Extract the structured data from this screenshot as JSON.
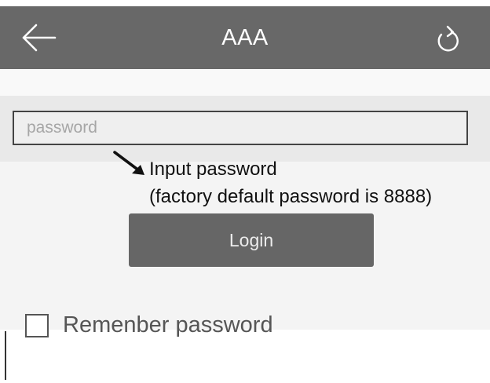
{
  "header": {
    "title": "AAA",
    "back_icon": "arrow-left-icon",
    "refresh_icon": "refresh-icon",
    "background_color": "#686868"
  },
  "login_form": {
    "password_placeholder": "password",
    "password_value": "",
    "hint_line_1": "Input password",
    "hint_line_2": "(factory default password is 8888)",
    "hint_arrow_icon": "arrow-down-right-icon",
    "login_label": "Login",
    "remember_label": "Remenber password",
    "remember_checked": false
  }
}
